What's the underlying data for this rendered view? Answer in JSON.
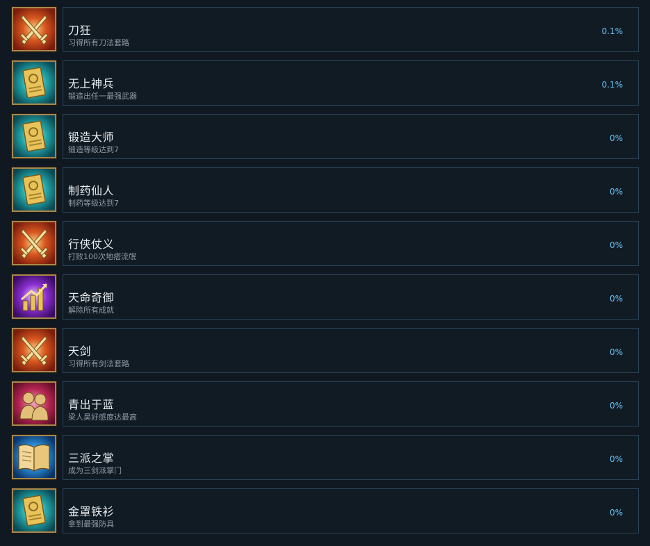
{
  "achievements": [
    {
      "title": "刀狂",
      "description": "习得所有刀法套路",
      "percent": "0.1%",
      "icon": "crossed-swords-icon"
    },
    {
      "title": "无上神兵",
      "description": "锻造出任一最强武器",
      "percent": "0.1%",
      "icon": "golden-card-icon"
    },
    {
      "title": "锻造大师",
      "description": "锻造等级达到7",
      "percent": "0%",
      "icon": "golden-card-icon"
    },
    {
      "title": "制药仙人",
      "description": "制药等级达到7",
      "percent": "0%",
      "icon": "golden-card-icon"
    },
    {
      "title": "行侠仗义",
      "description": "打败100次地痞流氓",
      "percent": "0%",
      "icon": "crossed-swords-icon"
    },
    {
      "title": "天命奇御",
      "description": "解除所有成就",
      "percent": "0%",
      "icon": "trophy-chart-icon"
    },
    {
      "title": "天剑",
      "description": "习得所有剑法套路",
      "percent": "0%",
      "icon": "crossed-swords-icon"
    },
    {
      "title": "青出于蓝",
      "description": "梁人昊好感度达最高",
      "percent": "0%",
      "icon": "portrait-pair-icon"
    },
    {
      "title": "三派之掌",
      "description": "成为三剑派掌门",
      "percent": "0%",
      "icon": "open-book-icon"
    },
    {
      "title": "金罩铁衫",
      "description": "拿到最强防具",
      "percent": "0%",
      "icon": "golden-card-icon"
    }
  ],
  "colors": {
    "background": "#101821",
    "card_border": "#2b4558",
    "title": "#e7ecef",
    "description": "#8d9aa5",
    "percent": "#67c1f5",
    "icon_frame": "#a8874d"
  }
}
